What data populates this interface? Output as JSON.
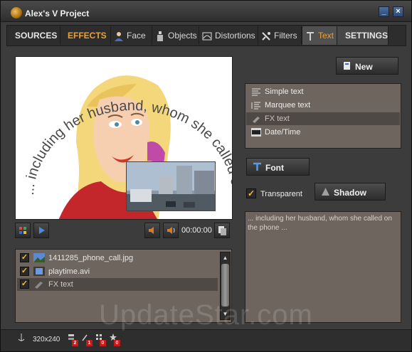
{
  "window": {
    "title": "Alex's V Project"
  },
  "tabs": [
    {
      "label": "SOURCES"
    },
    {
      "label": "EFFECTS"
    },
    {
      "label": "Face",
      "icon": "person-icon"
    },
    {
      "label": "Objects",
      "icon": "bottle-icon"
    },
    {
      "label": "Distortions",
      "icon": "distort-icon"
    },
    {
      "label": "Filters",
      "icon": "filter-icon"
    },
    {
      "label": "Text",
      "icon": "text-icon"
    },
    {
      "label": "SETTINGS"
    }
  ],
  "preview": {
    "caption": "... including her husband, whom she called on the phone ."
  },
  "controls": {
    "time": "00:00:00"
  },
  "files": [
    {
      "name": "1411285_phone_call.jpg",
      "checked": true,
      "icon": "image-icon"
    },
    {
      "name": "playtime.avi",
      "checked": true,
      "icon": "film-icon"
    },
    {
      "name": "FX text",
      "checked": true,
      "icon": "fx-text-icon",
      "selected": true
    }
  ],
  "right_panel": {
    "new_label": "New",
    "types": [
      {
        "label": "Simple text",
        "icon": "simple-text-icon"
      },
      {
        "label": "Marquee text",
        "icon": "marquee-icon"
      },
      {
        "label": "FX text",
        "icon": "fx-text-icon",
        "selected": true
      },
      {
        "label": "Date/Time",
        "icon": "datetime-icon"
      }
    ],
    "font_label": "Font",
    "transparent_label": "Transparent",
    "transparent_checked": true,
    "shadow_label": "Shadow",
    "text_value": "... including her husband, whom she called on the phone ..."
  },
  "status": {
    "resolution": "320x240",
    "counts": [
      "2",
      "1",
      "0",
      "0"
    ]
  },
  "watermark": "UpdateStar.com",
  "colors": {
    "accent": "#e8a33a",
    "panel": "#6e665e",
    "background": "#3c3c3c"
  }
}
